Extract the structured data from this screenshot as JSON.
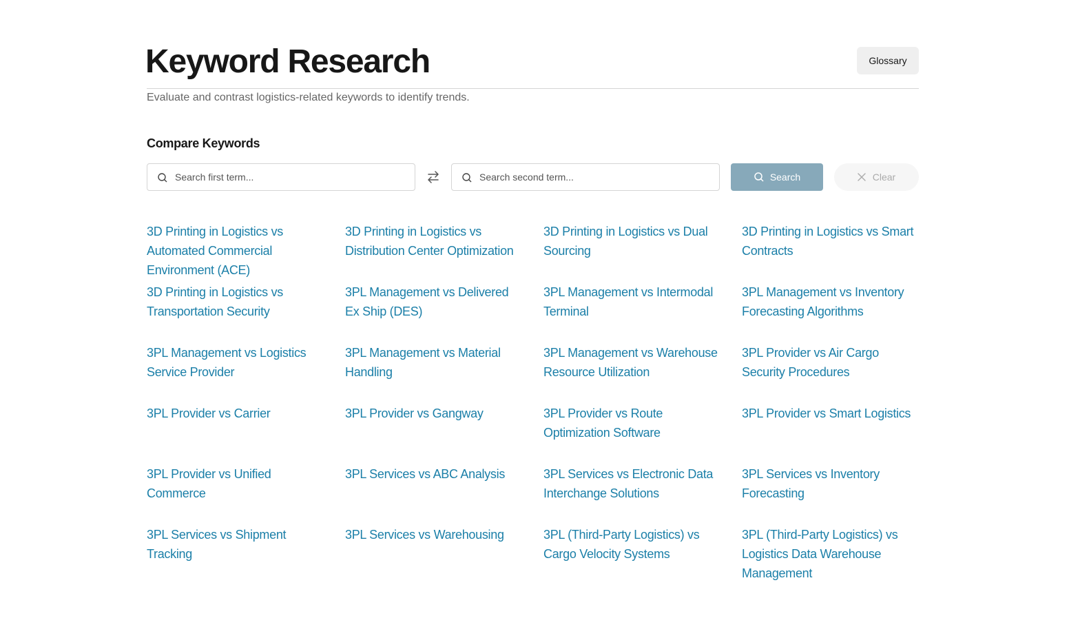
{
  "header": {
    "title": "Keyword Research",
    "glossary_label": "Glossary",
    "subtitle": "Evaluate and contrast logistics-related keywords to identify trends."
  },
  "compare": {
    "title": "Compare Keywords",
    "first_placeholder": "Search first term...",
    "second_placeholder": "Search second term...",
    "search_label": "Search",
    "clear_label": "Clear",
    "icons": [
      "search-icon",
      "swap-icon",
      "close-icon"
    ]
  },
  "colors": {
    "link": "#1b7fa8",
    "search_button": "#87a9ba"
  },
  "links": [
    "3D Printing in Logistics vs Automated Commercial Environment (ACE)",
    "3D Printing in Logistics vs Distribution Center Optimization",
    "3D Printing in Logistics vs Dual Sourcing",
    "3D Printing in Logistics vs Smart Contracts",
    "3D Printing in Logistics vs Transportation Security",
    "3PL Management vs Delivered Ex Ship (DES)",
    "3PL Management vs Intermodal Terminal",
    "3PL Management vs Inventory Forecasting Algorithms",
    "3PL Management vs Logistics Service Provider",
    "3PL Management vs Material Handling",
    "3PL Management vs Warehouse Resource Utilization",
    "3PL Provider vs Air Cargo Security Procedures",
    "3PL Provider vs Carrier",
    "3PL Provider vs Gangway",
    "3PL Provider vs Route Optimization Software",
    "3PL Provider vs Smart Logistics",
    "3PL Provider vs Unified Commerce",
    "3PL Services vs ABC Analysis",
    "3PL Services vs Electronic Data Interchange Solutions",
    "3PL Services vs Inventory Forecasting",
    "3PL Services vs Shipment Tracking",
    "3PL Services vs Warehousing",
    "3PL (Third-Party Logistics) vs Cargo Velocity Systems",
    "3PL (Third-Party Logistics) vs Logistics Data Warehouse Management"
  ]
}
